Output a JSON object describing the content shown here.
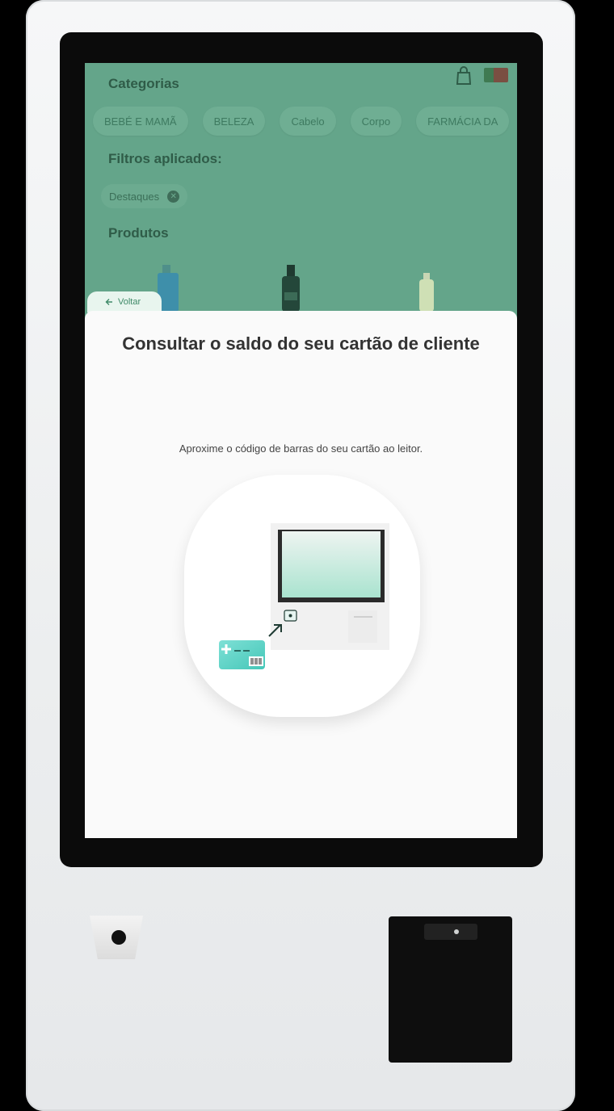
{
  "background_app": {
    "categories_title": "Categorias",
    "categories": [
      "BEBÉ E MAMÃ",
      "BELEZA",
      "Cabelo",
      "Corpo",
      "FARMÁCIA DA"
    ],
    "filters_title": "Filtros aplicados:",
    "applied_filter": "Destaques",
    "products_title": "Produtos"
  },
  "modal": {
    "back_label": "Voltar",
    "title": "Consultar o saldo do seu cartão de cliente",
    "instruction": "Aproxime o código de barras do seu cartão ao leitor."
  },
  "colors": {
    "overlay_green": "#64a58a",
    "accent_teal": "#5ad2c3",
    "modal_bg": "#fafafa"
  }
}
